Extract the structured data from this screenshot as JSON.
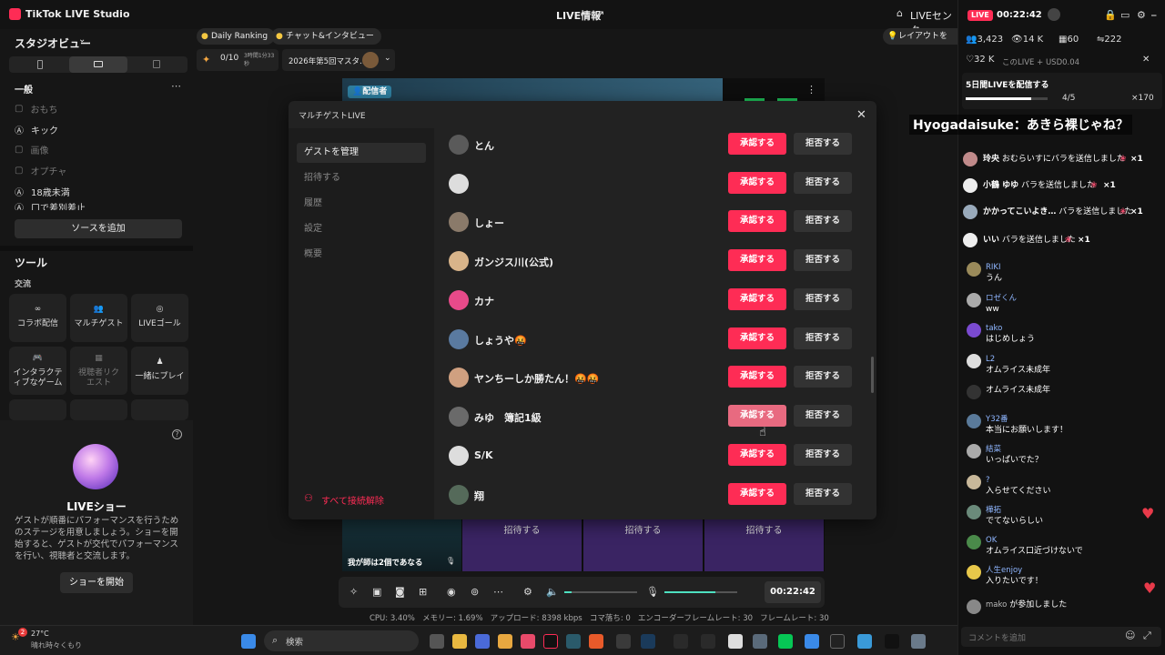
{
  "app": {
    "name": "TikTok LIVE Studio",
    "center_title": "LIVE情報",
    "right_link": "LIVEセンター"
  },
  "left": {
    "studio_view": "スタジオビュー",
    "general": "一般",
    "sources": [
      {
        "label": "おもち",
        "dim": true
      },
      {
        "label": "キック",
        "dim": false
      },
      {
        "label": "画像",
        "dim": true
      },
      {
        "label": "オプチャ",
        "dim": true
      },
      {
        "label": "18歳未満",
        "dim": false
      },
      {
        "label": "口で差別差止",
        "dim": false
      }
    ],
    "add_source": "ソースを追加",
    "tools_title": "ツール",
    "interaction": "交流",
    "tools": [
      {
        "label": "コラボ配信",
        "icon": "link-icon"
      },
      {
        "label": "マルチゲスト",
        "icon": "users-icon"
      },
      {
        "label": "LIVEゴール",
        "icon": "target-icon"
      },
      {
        "label": "インタラクティブなゲーム",
        "icon": "gamepad-icon"
      },
      {
        "label": "視聴者リクエスト",
        "icon": "gift-icon"
      },
      {
        "label": "一緒にプレイ",
        "icon": "play-together-icon"
      }
    ],
    "show": {
      "title": "LIVEショー",
      "desc": "ゲストが順番にパフォーマンスを行うためのステージを用意しましょう。ショーを開始すると、ゲストが交代でパフォーマンスを行い、視聴者と交流します。",
      "start": "ショーを開始"
    }
  },
  "top": {
    "daily_ranking": "Daily Ranking",
    "chat_interview": "チャット&インタビュー",
    "goal_count": "0/10",
    "goal_time": "3時間1分33秒",
    "event_name": "2026年第5回マスタ…",
    "layout_tip": "レイアウトを効率化"
  },
  "preview": {
    "host_label": "配信者",
    "caption": "我が師は2個であなる",
    "invite_slots": [
      "招待する",
      "招待する",
      "招待する"
    ]
  },
  "controls": {
    "timer": "00:22:42"
  },
  "status": {
    "cpu": "CPU: 3.40%",
    "memory": "メモリー: 1.69%",
    "upload": "アップロード: 8398 kbps",
    "dropped": "コマ落ち: 0",
    "encoder_fps": "エンコーダーフレームレート: 30",
    "fps": "フレームレート: 30"
  },
  "modal": {
    "title": "マルチゲストLIVE",
    "nav": [
      "ゲストを管理",
      "招待する",
      "履歴",
      "設定",
      "概要"
    ],
    "disconnect_all": "すべて接続解除",
    "approve": "承認する",
    "reject": "拒否する",
    "guests": [
      "とん",
      "",
      "しょー",
      "ガンジス川(公式)",
      "カナ",
      "しょうや🤬",
      "ヤンちーしか勝たん！🤬🤬",
      "みゆ　簿記1級",
      "S/K",
      "翔"
    ]
  },
  "right": {
    "live_badge": "LIVE",
    "timer": "00:22:42",
    "stats": {
      "viewers": "3,423",
      "views": "14 K",
      "gifts": "60",
      "likes": "222"
    },
    "hearts": "32 K",
    "promo": "このLIVE + USD0.04",
    "goal_title": "5日間LIVEを配信する",
    "goal_progress": "4/5",
    "goal_right": "×170",
    "goal_progress_value": 0.8,
    "highlight_msg": "Hyogadaisuke：あきら裸じゃね？",
    "gifts": [
      {
        "user": "玲央",
        "text": "おむらいすにバラを送信しました",
        "count": "×1"
      },
      {
        "user": "小鶴 ゆゆ",
        "text": "バラを送信しました",
        "count": "×1"
      },
      {
        "user": "かかってこいよき…",
        "text": "バラを送信しました",
        "count": "×1"
      },
      {
        "user": "いい",
        "text": "バラを送信しました",
        "count": "×1"
      }
    ],
    "chats": [
      {
        "user": "RIKI",
        "text": "うん"
      },
      {
        "user": "ロゼくん",
        "text": "ww"
      },
      {
        "user": "tako",
        "text": "はじめしょう"
      },
      {
        "user": "L2",
        "text": "オムライス未成年"
      },
      {
        "user": "",
        "text": "オムライス未成年"
      },
      {
        "user": "Y32番",
        "text": "本当にお願いします！"
      },
      {
        "user": "結菜",
        "text": "いっぱいでた？"
      },
      {
        "user": "?",
        "text": "入らせてください"
      },
      {
        "user": "樺拓",
        "text": "でてないらしい"
      },
      {
        "user": "OK",
        "text": "オムライス口近づけないで"
      },
      {
        "user": "人生enjoy",
        "text": "入りたいです！"
      },
      {
        "user": "mako",
        "text": "が参加しました"
      }
    ],
    "comment_placeholder": "コメントを追加"
  },
  "taskbar": {
    "temp": "27°C",
    "weather": "晴れ時々くもり",
    "search": "検索",
    "badge": "2"
  },
  "colors": {
    "accent": "#fe2c55",
    "panel": "#222222",
    "guest_slot": "#3a2463"
  }
}
